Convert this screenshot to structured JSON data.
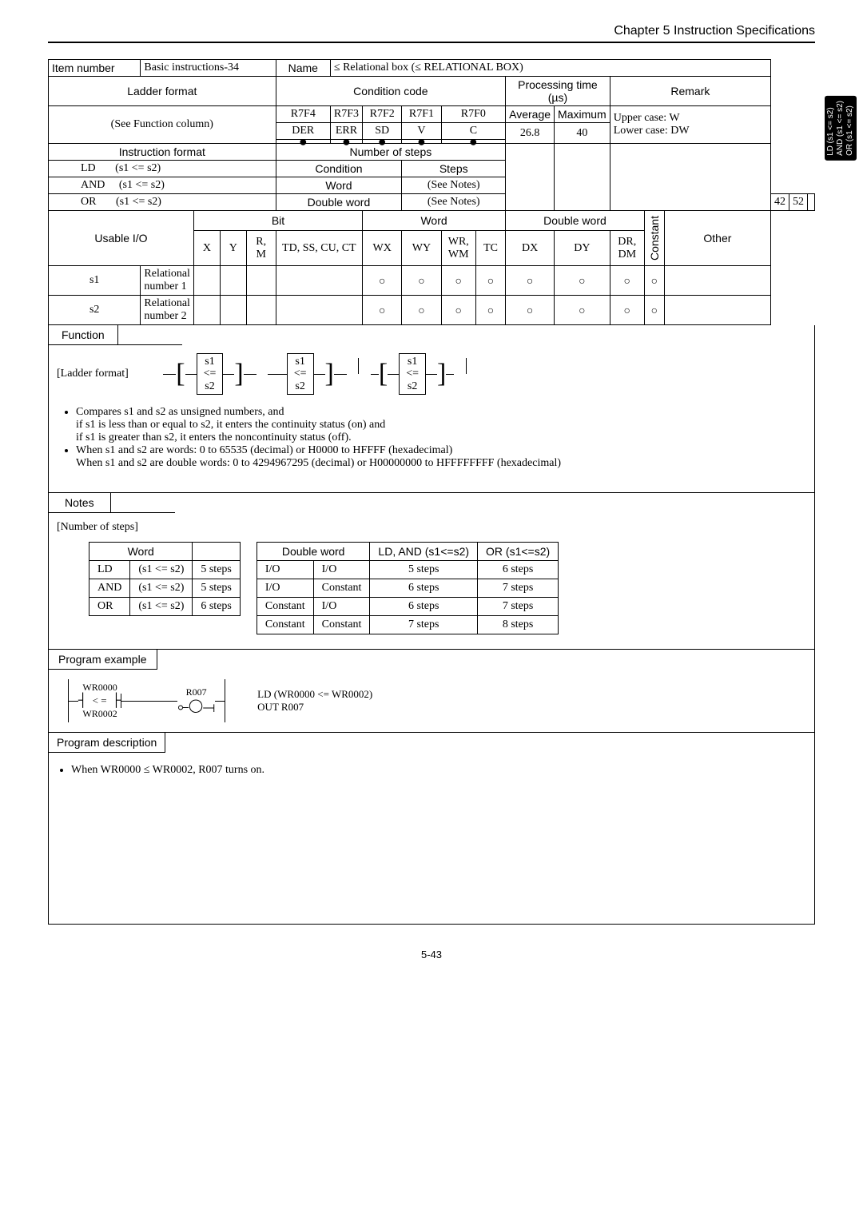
{
  "chapter_title": "Chapter 5  Instruction Specifications",
  "side_tab": [
    "LD   (s1 <= s2)",
    "AND (s1 <= s2)",
    "OR   (s1 <= s2)"
  ],
  "hdr": {
    "item_number": "Item number",
    "basic_instr": "Basic instructions-34",
    "name_lbl": "Name",
    "name_val": "≤ Relational box (≤ RELATIONAL BOX)",
    "ladder_format": "Ladder format",
    "condition_code": "Condition code",
    "processing_time": "Processing time (µs)",
    "remark": "Remark",
    "see_func": "(See Function column)",
    "upper": "Upper case: W",
    "lower": "Lower case: DW",
    "instr_format": "Instruction format",
    "num_steps": "Number of steps",
    "average": "Average",
    "maximum": "Maximum",
    "steps_lbl": "Steps",
    "condition": "Condition",
    "word": "Word",
    "double_word": "Double word",
    "see_notes": "(See Notes)"
  },
  "cc": {
    "r7f4": "R7F4",
    "r7f3": "R7F3",
    "r7f2": "R7F2",
    "r7f1": "R7F1",
    "r7f0": "R7F0",
    "der": "DER",
    "err": "ERR",
    "sd": "SD",
    "v": "V",
    "c": "C"
  },
  "time": {
    "avg": "26.8",
    "max": "40",
    "line2": "42",
    "line2b": "52"
  },
  "instr_rows": [
    {
      "op": "LD",
      "arg": "(s1 <= s2)"
    },
    {
      "op": "AND",
      "arg": "(s1 <= s2)"
    },
    {
      "op": "OR",
      "arg": "(s1 <= s2)"
    }
  ],
  "usable": {
    "label": "Usable I/O",
    "bit": "Bit",
    "word": "Word",
    "dword": "Double word",
    "constant": "Constant",
    "other": "Other",
    "cols": {
      "x": "X",
      "y": "Y",
      "rm": "R, M",
      "tdss": "TD, SS, CU, CT",
      "wx": "WX",
      "wy": "WY",
      "wrwm": "WR, WM",
      "tc": "TC",
      "dx": "DX",
      "dy": "DY",
      "drdm": "DR, DM"
    }
  },
  "operands": [
    {
      "id": "s1",
      "name": "Relational number 1"
    },
    {
      "id": "s2",
      "name": "Relational number 2"
    }
  ],
  "function_lbl": "Function",
  "ladder_fmt_title": "[Ladder format]",
  "ladder_boxes": {
    "s1": "s1",
    "le": "<=",
    "s2": "s2"
  },
  "func_bullets": [
    "Compares s1 and s2 as unsigned numbers, and",
    "if s1 is less than or equal to s2, it enters the continuity status (on) and",
    "if s1 is greater than s2, it enters the noncontinuity status (off).",
    "When s1 and s2 are words:           0 to 65535 (decimal) or H0000 to HFFFF (hexadecimal)",
    "When s1 and s2 are double words:   0 to 4294967295 (decimal) or H00000000 to HFFFFFFFF (hexadecimal)"
  ],
  "notes_lbl": "Notes",
  "num_steps_title": "[Number of steps]",
  "steps_tbl": {
    "headers": [
      "Word",
      "Double word",
      "LD, AND (s1<=s2)",
      "OR (s1<=s2)"
    ],
    "rows": [
      {
        "op": "LD",
        "arg": "(s1 <= s2)",
        "w": "5 steps",
        "a": "I/O",
        "b": "I/O",
        "c": "5 steps",
        "d": "6 steps"
      },
      {
        "op": "AND",
        "arg": "(s1 <= s2)",
        "w": "5 steps",
        "a": "I/O",
        "b": "Constant",
        "c": "6 steps",
        "d": "7 steps"
      },
      {
        "op": "OR",
        "arg": "(s1 <= s2)",
        "w": "6 steps",
        "a": "Constant",
        "b": "I/O",
        "c": "6 steps",
        "d": "7 steps"
      },
      {
        "op": "",
        "arg": "",
        "w": "",
        "a": "Constant",
        "b": "Constant",
        "c": "7 steps",
        "d": "8 steps"
      }
    ]
  },
  "prog_example_lbl": "Program example",
  "prog": {
    "contact": "WR0000",
    "coil": "R007",
    "branch": "WR0002",
    "sym": "< =",
    "out_lines": [
      "LD     (WR0000 <= WR0002)",
      "OUT   R007"
    ]
  },
  "prog_desc_lbl": "Program description",
  "prog_desc_text": "When WR0000 ≤ WR0002, R007 turns on.",
  "page_num": "5-43"
}
